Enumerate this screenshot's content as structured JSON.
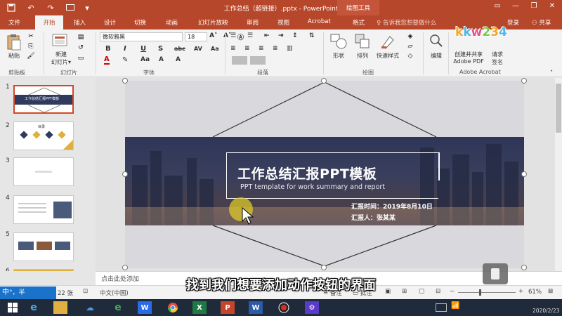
{
  "titlebar": {
    "doc_title": "工作总结（超链接）.pptx - PowerPoint",
    "context_tab": "绘图工具",
    "save_icon": "save-icon",
    "undo_icon": "undo-icon",
    "redo_icon": "redo-icon"
  },
  "tabs": {
    "file": "文件",
    "home": "开始",
    "insert": "插入",
    "design": "设计",
    "transitions": "切换",
    "animations": "动画",
    "slideshow": "幻灯片放映",
    "review": "审阅",
    "view": "视图",
    "acrobat": "Acrobat",
    "format": "格式",
    "tell_me": "告诉我您想要做什么",
    "login": "登录",
    "share": "共享"
  },
  "ribbon": {
    "paste": "粘贴",
    "clipboard": "剪贴板",
    "new_slide_line1": "新建",
    "new_slide_line2": "幻灯片",
    "slides": "幻灯片",
    "font_name": "微软雅黑",
    "font_size": "18",
    "font": "字体",
    "paragraph": "段落",
    "shape": "形状",
    "arrange": "排列",
    "quick_styles": "快速样式",
    "drawing": "绘图",
    "edit": "编辑",
    "create_share_line1": "创建并共享",
    "create_share_line2": "Adobe PDF",
    "request_sign_line1": "请求",
    "request_sign_line2": "签名",
    "adobe_acrobat": "Adobe Acrobat"
  },
  "logo": {
    "text": "kkw234",
    "colors": [
      "#f5a623",
      "#4fb6e8",
      "#e84f8f",
      "#7ac943",
      "#f5a623",
      "#4fb6e8"
    ]
  },
  "slides_panel": {
    "items": [
      {
        "num": "1",
        "title": "工作总结汇报PPT模板",
        "selected": true
      },
      {
        "num": "2",
        "title": "目录"
      },
      {
        "num": "3"
      },
      {
        "num": "4"
      },
      {
        "num": "5"
      },
      {
        "num": "6"
      }
    ]
  },
  "slide": {
    "title": "工作总结汇报PPT模板",
    "subtitle": "PPT template for work summary and report",
    "date_line": "汇报时间：2019年8月10日",
    "reporter_line": "汇报人：张某某"
  },
  "notes": {
    "placeholder": "点击此处添加"
  },
  "caption": "找到我们想要添加动作按钮的界面",
  "statusbar": {
    "ime": "中",
    "ime_extra": "°，半",
    "slide_count": "22 张",
    "language": "中文(中国)",
    "notes_label": "备注",
    "comments_label": "批注",
    "zoom": "61%"
  },
  "taskbar": {
    "date": "2020/2/23",
    "apps": [
      "start-icon",
      "file-explorer-icon",
      "baidu-netdisk-icon",
      "ie-icon",
      "wps-icon",
      "chrome-icon",
      "excel-icon",
      "powerpoint-icon",
      "word-icon",
      "recorder-icon",
      "settings-icon"
    ]
  },
  "colors": {
    "accent": "#b7472a",
    "slide_band": "#2f3a5c",
    "taskbar": "#1f2a3a"
  }
}
